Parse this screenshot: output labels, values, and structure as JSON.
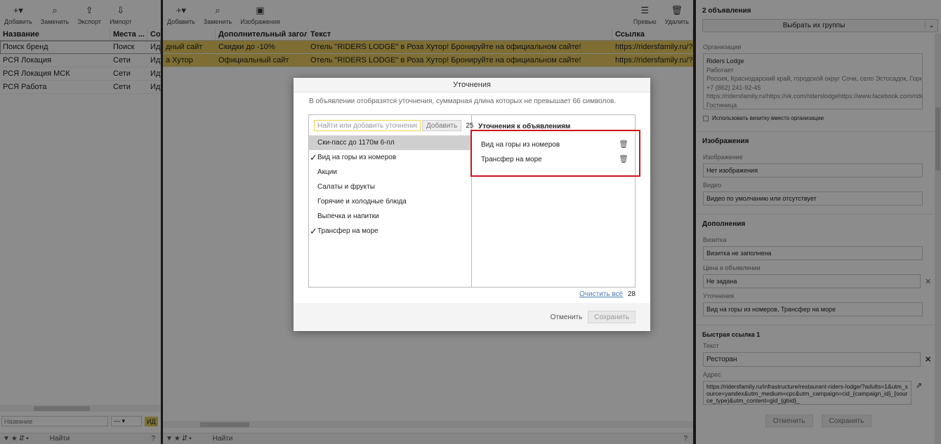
{
  "left_panel": {
    "toolbar": [
      {
        "icon": "plus-icon",
        "label": "Добавить"
      },
      {
        "icon": "search-icon",
        "label": "Заменить"
      },
      {
        "icon": "export-icon",
        "label": "Экспорт"
      },
      {
        "icon": "import-icon",
        "label": "Импорт"
      }
    ],
    "columns": [
      "Название",
      "Места ...",
      "Со"
    ],
    "rows": [
      {
        "name": "Поиск бренд",
        "place": "Поиск",
        "status": "Иду"
      },
      {
        "name": "РСЯ Локация",
        "place": "Сети",
        "status": "Иду"
      },
      {
        "name": "РСЯ Локация МСК",
        "place": "Сети",
        "status": "Иду"
      },
      {
        "name": "РСЯ Работа",
        "place": "Сети",
        "status": "Иду"
      }
    ],
    "filter_placeholder": "Название",
    "filter_select": "—",
    "filter_chip": "ИД",
    "search_placeholder": "Найти",
    "help": "?"
  },
  "center_panel": {
    "toolbar": [
      {
        "icon": "plus-icon",
        "label": "Добавить"
      },
      {
        "icon": "search-icon",
        "label": "Заменить"
      },
      {
        "icon": "image-icon",
        "label": "Изображения"
      }
    ],
    "toolbar_right": [
      {
        "icon": "preview-icon",
        "label": "Превью"
      },
      {
        "icon": "trash-icon",
        "label": "Удалить"
      }
    ],
    "columns": [
      "Дополнительный загол...",
      "Текст",
      "Ссылка"
    ],
    "rows": [
      {
        "c0": "дный сайт",
        "c1": "Скидки до -10%",
        "c2": "Отель \"RIDERS LODGE\" в Роза Хутор! Бронируйте на официальном сайте!",
        "c3": "https://ridersfamily.ru/?utm_"
      },
      {
        "c0": "а Хутор",
        "c1": "Официальный сайт",
        "c2": "Отель \"RIDERS LODGE\" в Роза Хутор! Бронируйте на официальном сайте!",
        "c3": "https://ridersfamily.ru/?utm_"
      }
    ],
    "search_placeholder": "Найти",
    "help": "?"
  },
  "right_panel": {
    "group_count": "2 объявления",
    "group_button": "Выбрать их группы",
    "org_label": "Организации",
    "org_lines": [
      "Riders Lodge",
      "Работает",
      "Россия, Краснодарский край, городской округ Сочи, село Эстосадок, Горная Оли",
      "+7 (862) 241-92-45",
      "https://ridersfamily.ru/https://vk.com/riderslodgehttps://www.facebook.com/riders",
      "Гостиница"
    ],
    "use_card_label": "Использовать визитку вместо организации",
    "images_section": "Изображения",
    "image_label": "Изображение",
    "image_value": "Нет изображения",
    "video_label": "Видео",
    "video_value": "Видео по умолчанию или отсутствует",
    "additions_section": "Дополнения",
    "card_label": "Визитка",
    "card_value": "Визитка не заполнена",
    "price_label": "Цена в объявлении",
    "price_value": "Не задана",
    "refinements_label": "Уточнения",
    "refinements_value": "Вид на горы из номеров, Трансфер на море",
    "quicklink_section": "Быстрая ссылка 1",
    "text_label": "Текст",
    "text_value": "Ресторан",
    "address_label": "Адрес",
    "address_value": "https://ridersfamily.ru/infrastructure/restaurant-riders-lodge/?adults=1&utm_source=yandex&utm_medium=cpc&utm_campaign=cid_{campaign_id}_{source_type}&utm_content=gid_{gbid}_",
    "cancel": "Отменить",
    "save": "Сохранить"
  },
  "modal": {
    "title": "Уточнения",
    "description": "В объявлении отобразятся уточнения, суммарная длина которых не превышает 66 символов.",
    "search_placeholder": "Найти или добавить уточнение",
    "add_button": "Добавить",
    "left_count": "25",
    "options": [
      {
        "label": "Ски-пасс до 1170м 6-пл",
        "checked": false,
        "highlighted": true
      },
      {
        "label": "Вид на горы из номеров",
        "checked": true,
        "highlighted": false
      },
      {
        "label": "Акции",
        "checked": false,
        "highlighted": false
      },
      {
        "label": "Салаты и фрукты",
        "checked": false,
        "highlighted": false
      },
      {
        "label": "Горячие и холодные блюда",
        "checked": false,
        "highlighted": false
      },
      {
        "label": "Выпечка и напитки",
        "checked": false,
        "highlighted": false
      },
      {
        "label": "Трансфер на море",
        "checked": true,
        "highlighted": false
      }
    ],
    "selected_title": "Уточнения к объявлениям",
    "selected": [
      "Вид на горы из номеров",
      "Трансфер на море"
    ],
    "clear_all": "Очистить всё",
    "right_count": "28",
    "cancel": "Отменить",
    "save": "Сохранить"
  },
  "colors": {
    "selected_row": "#e6c95f",
    "highlight_box": "#d0121b",
    "link": "#4a7fb5"
  }
}
